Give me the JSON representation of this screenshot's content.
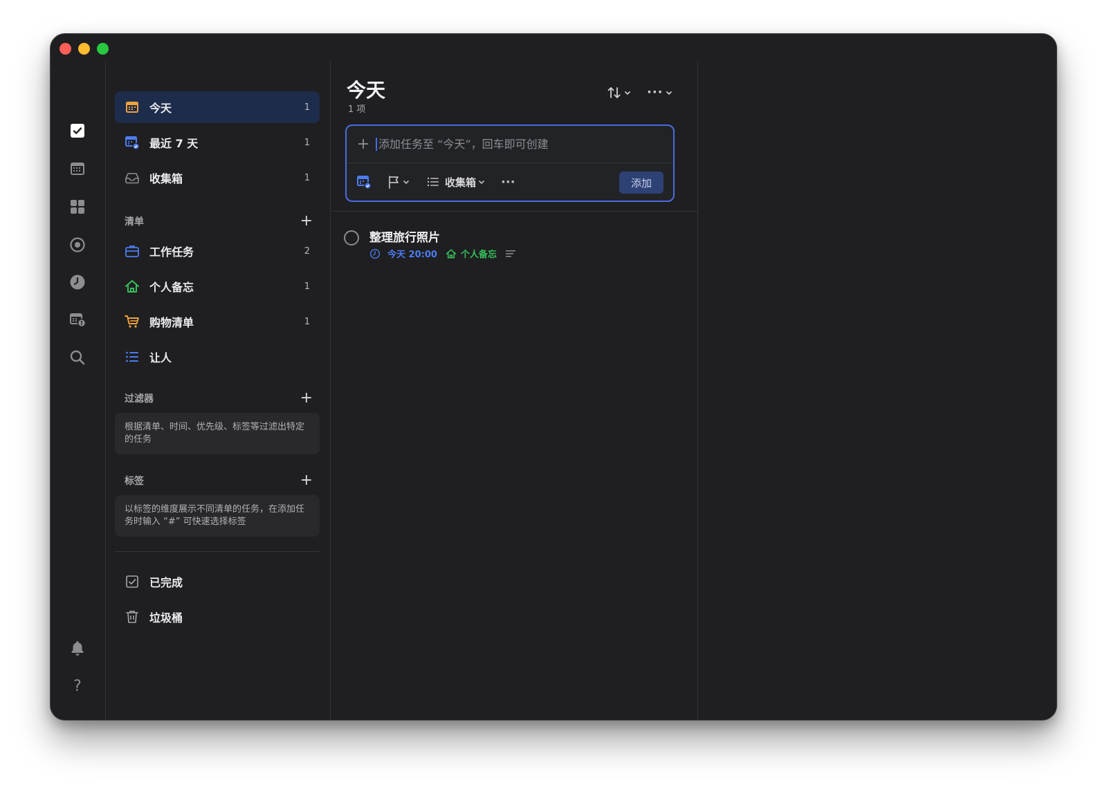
{
  "colors": {
    "window_bg": "#1f1f21",
    "accent": "#4a6ce0",
    "active_bg": "#1e2c4c",
    "date_blue": "#4c7cf0",
    "list_green": "#35c15b"
  },
  "rail": {
    "icons": [
      "checkbox-icon",
      "calendar-icon",
      "grid-icon",
      "focus-icon",
      "clock-icon",
      "calendar-alert-icon",
      "search-icon",
      "bell-icon",
      "help-icon"
    ],
    "help_glyph": "?"
  },
  "sidebar": {
    "smart_lists": [
      {
        "label": "今天",
        "count": "1",
        "icon": "calendar-today-icon"
      },
      {
        "label": "最近 7 天",
        "count": "1",
        "icon": "calendar-week-icon"
      },
      {
        "label": "收集箱",
        "count": "1",
        "icon": "inbox-icon"
      }
    ],
    "lists_section": {
      "title": "清单",
      "plus": "+"
    },
    "lists": [
      {
        "label": "工作任务",
        "count": "2",
        "icon": "briefcase-icon"
      },
      {
        "label": "个人备忘",
        "count": "1",
        "icon": "home-icon"
      },
      {
        "label": "购物清单",
        "count": "1",
        "icon": "cart-icon"
      },
      {
        "label": "让人",
        "count": "",
        "icon": "list-icon"
      }
    ],
    "filters_section": {
      "title": "过滤器",
      "plus": "+",
      "hint": "根据清单、时间、优先级、标签等过滤出特定的任务"
    },
    "tags_section": {
      "title": "标签",
      "plus": "+",
      "hint": "以标签的维度展示不同清单的任务，在添加任务时输入 “#” 可快速选择标签"
    },
    "bottom": [
      {
        "label": "已完成",
        "icon": "checked-box-icon"
      },
      {
        "label": "垃圾桶",
        "icon": "trash-icon"
      }
    ]
  },
  "main": {
    "title": "今天",
    "subtitle": "1 项",
    "more_glyph": "···",
    "add_task": {
      "plus": "+",
      "placeholder": "添加任务至 “今天”，回车即可创建",
      "list_label": "收集箱",
      "more": "···",
      "add_button": "添加"
    },
    "tasks": [
      {
        "title": "整理旅行照片",
        "date": "今天 20:00",
        "list": "个人备忘"
      }
    ]
  }
}
